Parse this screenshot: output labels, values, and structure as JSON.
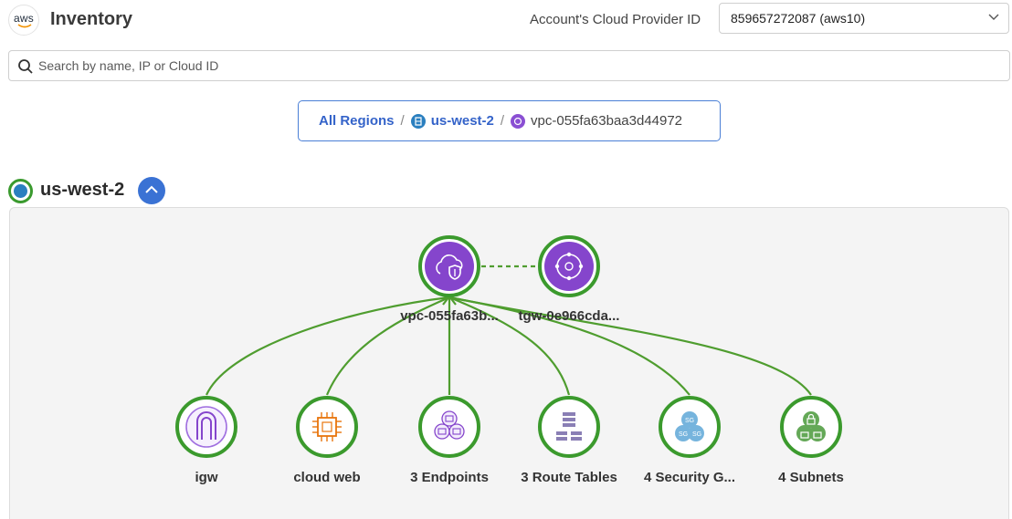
{
  "header": {
    "logo_text": "aws",
    "title": "Inventory",
    "provider_label": "Account's Cloud Provider ID",
    "provider_value": "859657272087 (aws10)"
  },
  "search": {
    "placeholder": "Search by name, IP or Cloud ID",
    "value": ""
  },
  "breadcrumb": {
    "all_regions": "All Regions",
    "separator": "/",
    "region": "us-west-2",
    "vpc": "vpc-055fa63baa3d44972"
  },
  "region_section": {
    "name": "us-west-2",
    "expanded": true
  },
  "topology": {
    "vpc": {
      "label": "vpc-055fa63b...",
      "icon": "vpc-cloud-shield-icon"
    },
    "tgw": {
      "label": "tgw-0e966cda...",
      "icon": "transit-gateway-icon"
    },
    "children": [
      {
        "label": "igw",
        "icon": "internet-gateway-icon"
      },
      {
        "label": "cloud web",
        "icon": "ec2-instance-chip-icon"
      },
      {
        "label": "3 Endpoints",
        "icon": "endpoints-icon"
      },
      {
        "label": "3 Route Tables",
        "icon": "route-tables-icon"
      },
      {
        "label": "4 Security G...",
        "icon": "security-groups-icon"
      },
      {
        "label": "4 Subnets",
        "icon": "subnets-lock-icon"
      }
    ]
  },
  "colors": {
    "accent_blue": "#3463c9",
    "node_ring_green": "#3b9a2d",
    "edge_green": "#4f9d2f",
    "vpc_purple": "#8545cc",
    "canvas_bg": "#f4f4f4"
  }
}
